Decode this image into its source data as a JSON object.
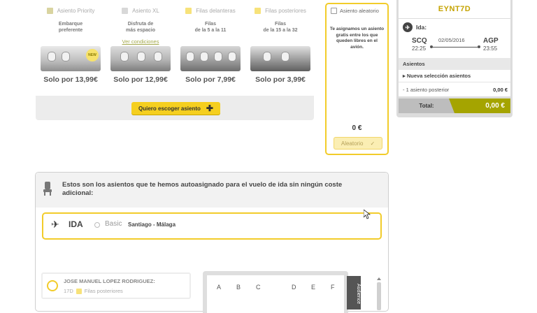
{
  "options": [
    {
      "name": "Asiento Priority",
      "desc1": "Embarque",
      "desc2": "preferente",
      "link": "",
      "price": "Solo por 13,99€",
      "badge": "NEW"
    },
    {
      "name": "Asiento XL",
      "desc1": "Disfruta de",
      "desc2": "más espacio",
      "link": "Ver condiciones",
      "price": "Solo por 12,99€",
      "badge": ""
    },
    {
      "name": "Filas delanteras",
      "desc1": "Filas",
      "desc2": "de la 5 a la 11",
      "link": "",
      "price": "Solo por 7,99€",
      "badge": ""
    },
    {
      "name": "Filas posteriores",
      "desc1": "Filas",
      "desc2": "de la 15 a la 32",
      "link": "",
      "price": "Solo por 3,99€",
      "badge": ""
    }
  ],
  "choose_button": "Quiero escoger asiento",
  "random": {
    "label": "Asiento aleatorio",
    "text": "Te asignamos un asiento gratis entre los que queden libres en el avión.",
    "price": "0 €",
    "button": "Aleatorio"
  },
  "summary": {
    "pnr": "EYNT7D",
    "ida": "Ida:",
    "from": "SCQ",
    "to": "AGP",
    "date": "02/05/2016",
    "dep": "22:25",
    "arr": "23:55",
    "asientos": "Asientos",
    "nueva": "Nueva selección asientos",
    "seat_line": "- 1 asiento posterior",
    "seat_price": "0,00 €",
    "total_label": "Total:",
    "total_value": "0,00 €"
  },
  "auto": {
    "title": "Estos son los asientos que te hemos autoasignado para el vuelo de ida sin ningún coste adicional:",
    "ida": "IDA",
    "fare": "Basic",
    "route": "Santiago - Málaga",
    "pax_name": "JOSE MANUEL LOPEZ RODRIGUEZ:",
    "pax_seat": "17D",
    "pax_zone": "Filas posteriores",
    "columns": [
      "A",
      "B",
      "C",
      "D",
      "E",
      "F"
    ],
    "side_tab": "Audience"
  },
  "colors": {
    "accent": "#f2cc2a",
    "olive": "#a5a400",
    "pnr": "#c5a300"
  }
}
